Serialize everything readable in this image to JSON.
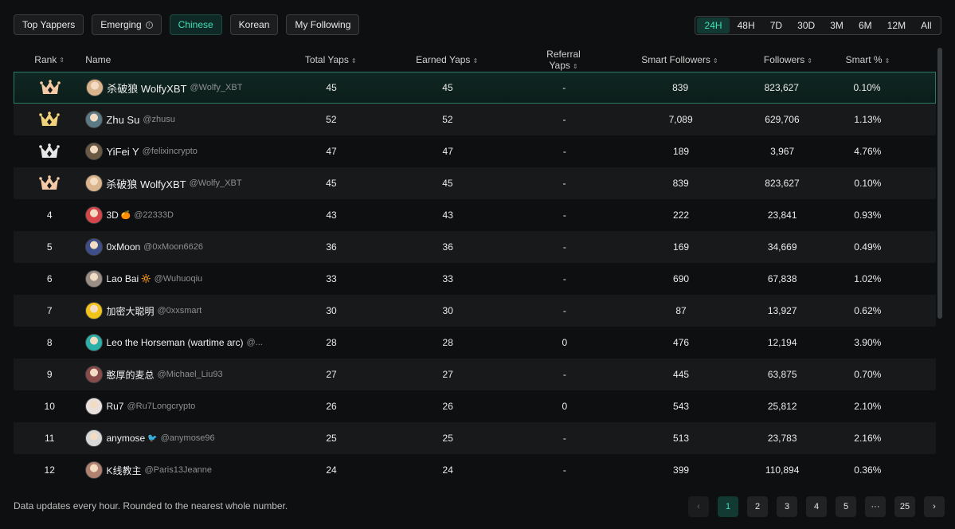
{
  "filters": [
    {
      "label": "Top Yappers"
    },
    {
      "label": "Emerging",
      "info": "i"
    },
    {
      "label": "Chinese",
      "active": true
    },
    {
      "label": "Korean"
    },
    {
      "label": "My Following"
    }
  ],
  "time_ranges": [
    "24H",
    "48H",
    "7D",
    "30D",
    "3M",
    "6M",
    "12M",
    "All"
  ],
  "active_time_range": "24H",
  "columns": {
    "rank": "Rank",
    "name": "Name",
    "total": "Total Yaps",
    "earned": "Earned Yaps",
    "referral": "Referral Yaps",
    "smart": "Smart Followers",
    "followers": "Followers",
    "pct": "Smart %"
  },
  "sort_glyph": "⇕",
  "rows": [
    {
      "rank": "3",
      "crown": "bronze",
      "name": "杀破狼 WolfyXBT",
      "handle": "@Wolfy_XBT",
      "total": "45",
      "earned": "45",
      "referral": "-",
      "smart": "839",
      "followers": "823,627",
      "pct": "0.10%",
      "highlight": true,
      "avatar": "#d9b48c"
    },
    {
      "rank": "1",
      "crown": "gold",
      "name": "Zhu Su",
      "handle": "@zhusu",
      "total": "52",
      "earned": "52",
      "referral": "-",
      "smart": "7,089",
      "followers": "629,706",
      "pct": "1.13%",
      "avatar": "#5a7a86"
    },
    {
      "rank": "2",
      "crown": "silver",
      "name": "YiFei Y",
      "handle": "@felixincrypto",
      "total": "47",
      "earned": "47",
      "referral": "-",
      "smart": "189",
      "followers": "3,967",
      "pct": "4.76%",
      "avatar": "#6a5a44"
    },
    {
      "rank": "3",
      "crown": "bronze",
      "name": "杀破狼 WolfyXBT",
      "handle": "@Wolfy_XBT",
      "total": "45",
      "earned": "45",
      "referral": "-",
      "smart": "839",
      "followers": "823,627",
      "pct": "0.10%",
      "avatar": "#d9b48c"
    },
    {
      "rank": "4",
      "name": "3D",
      "emoji": "🍊",
      "handle": "@22333D",
      "total": "43",
      "earned": "43",
      "referral": "-",
      "smart": "222",
      "followers": "23,841",
      "pct": "0.93%",
      "avatar": "#d6454a"
    },
    {
      "rank": "5",
      "name": "0xMoon",
      "handle": "@0xMoon6626",
      "total": "36",
      "earned": "36",
      "referral": "-",
      "smart": "169",
      "followers": "34,669",
      "pct": "0.49%",
      "avatar": "#3e4e8a"
    },
    {
      "rank": "6",
      "name": "Lao Bai",
      "emoji": "🔆",
      "handle": "@Wuhuoqiu",
      "total": "33",
      "earned": "33",
      "referral": "-",
      "smart": "690",
      "followers": "67,838",
      "pct": "1.02%",
      "avatar": "#9a8e86"
    },
    {
      "rank": "7",
      "name": "加密大聪明",
      "handle": "@0xxsmart",
      "total": "30",
      "earned": "30",
      "referral": "-",
      "smart": "87",
      "followers": "13,927",
      "pct": "0.62%",
      "avatar": "#f0c419"
    },
    {
      "rank": "8",
      "name": "Leo the Horseman (wartime arc)",
      "handle": "@...",
      "total": "28",
      "earned": "28",
      "referral": "0",
      "smart": "476",
      "followers": "12,194",
      "pct": "3.90%",
      "avatar": "#2ab0a8"
    },
    {
      "rank": "9",
      "name": "憨厚的麦总",
      "handle": "@Michael_Liu93",
      "total": "27",
      "earned": "27",
      "referral": "-",
      "smart": "445",
      "followers": "63,875",
      "pct": "0.70%",
      "avatar": "#8a4a4a"
    },
    {
      "rank": "10",
      "name": "Ru7",
      "handle": "@Ru7Longcrypto",
      "total": "26",
      "earned": "26",
      "referral": "0",
      "smart": "543",
      "followers": "25,812",
      "pct": "2.10%",
      "avatar": "#e8e0dc"
    },
    {
      "rank": "11",
      "name": "anymose",
      "emoji": "🐦",
      "handle": "@anymose96",
      "total": "25",
      "earned": "25",
      "referral": "-",
      "smart": "513",
      "followers": "23,783",
      "pct": "2.16%",
      "avatar": "#d8d8d8"
    },
    {
      "rank": "12",
      "name": "K线教主",
      "handle": "@Paris13Jeanne",
      "total": "24",
      "earned": "24",
      "referral": "-",
      "smart": "399",
      "followers": "110,894",
      "pct": "0.36%",
      "avatar": "#b08070"
    }
  ],
  "footer": {
    "note": "Data updates every hour. Rounded to the nearest whole number."
  },
  "pagination": {
    "prev": "‹",
    "pages": [
      "1",
      "2",
      "3",
      "4",
      "5",
      "···",
      "25"
    ],
    "active": "1",
    "next": "›"
  },
  "colors": {
    "accent": "#3fe0b8",
    "gold": "#f2d27a",
    "silver": "#e8e8e8",
    "bronze": "#f3c9a6"
  }
}
